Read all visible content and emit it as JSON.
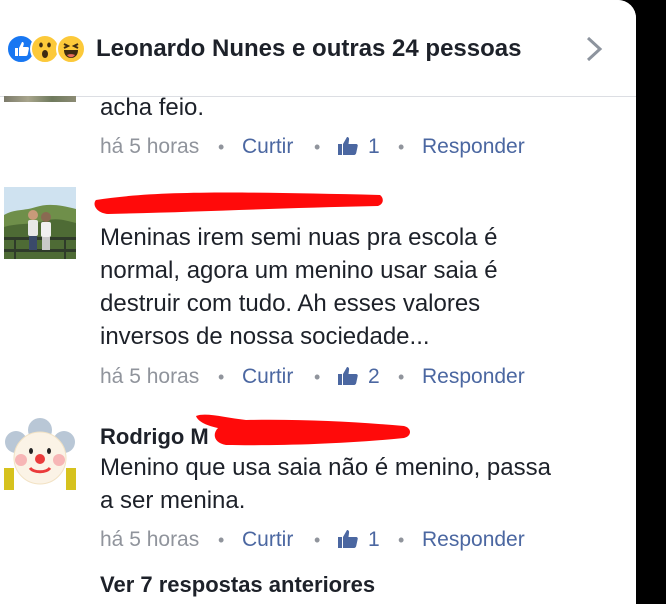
{
  "header": {
    "reaction_icons": [
      "like-icon",
      "wow-icon",
      "haha-icon"
    ],
    "title": "Leonardo Nunes e outras 24 pessoas",
    "chevron_icon": "chevron-right-icon"
  },
  "comments": [
    {
      "author": "",
      "lines": [
        "acha feio."
      ],
      "time": "há 5 horas",
      "like_label": "Curtir",
      "like_count": "1",
      "reply_label": "Responder"
    },
    {
      "author": "",
      "lines": [
        "Meninas irem semi nuas pra escola é",
        "normal, agora um menino usar saia é",
        "destruir com tudo. Ah esses valores",
        "inversos de nossa sociedade..."
      ],
      "time": "há 5 horas",
      "like_label": "Curtir",
      "like_count": "2",
      "reply_label": "Responder"
    },
    {
      "author": "Rodrigo M",
      "lines": [
        "Menino que usa saia não é menino, passa",
        "a ser menina."
      ],
      "time": "há 5 horas",
      "like_label": "Curtir",
      "like_count": "1",
      "reply_label": "Responder"
    }
  ],
  "separator": "•",
  "more_replies": "Ver 7 respostas anteriores",
  "colors": {
    "link_blue": "#4b67a1",
    "meta_gray": "#90949c",
    "text": "#1d2129",
    "redaction_red": "#ff0a0a"
  }
}
